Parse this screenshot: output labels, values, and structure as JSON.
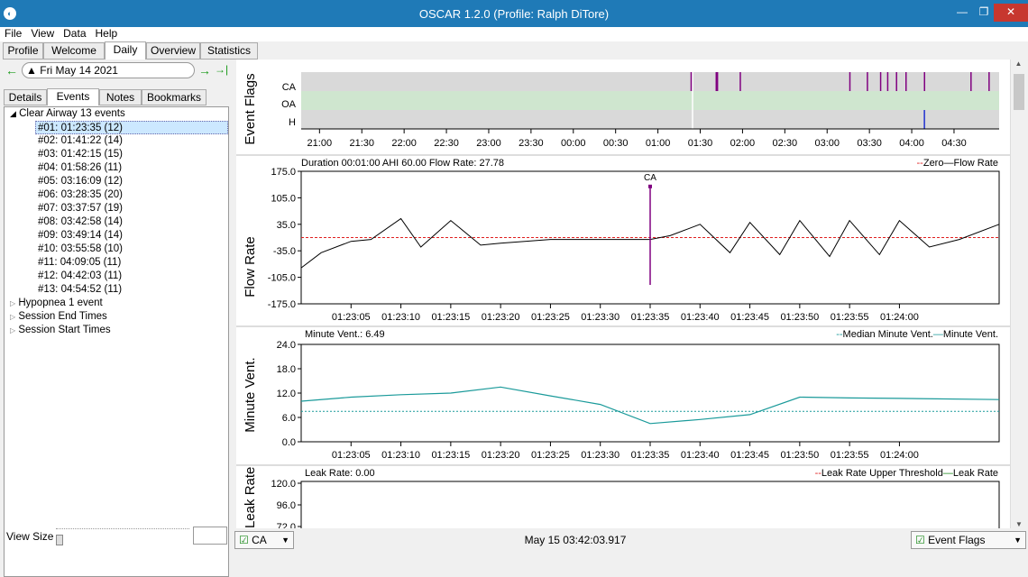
{
  "window": {
    "title": "OSCAR 1.2.0 (Profile: Ralph DiTore)",
    "app_icon": "oscar-app-icon"
  },
  "menu": [
    "File",
    "View",
    "Data",
    "Help"
  ],
  "main_tabs": [
    {
      "label": "Profile"
    },
    {
      "label": "Welcome"
    },
    {
      "label": "Daily",
      "active": true
    },
    {
      "label": "Overview"
    },
    {
      "label": "Statistics"
    }
  ],
  "date_nav": {
    "date": "Fri May 14 2021"
  },
  "sub_tabs": [
    {
      "label": "Details"
    },
    {
      "label": "Events",
      "active": true
    },
    {
      "label": "Notes"
    },
    {
      "label": "Bookmarks"
    }
  ],
  "event_tree": {
    "clear_airway": "Clear Airway 13 events",
    "items": [
      "#01: 01:23:35 (12)",
      "#02: 01:41:22 (14)",
      "#03: 01:42:15 (15)",
      "#04: 01:58:26 (11)",
      "#05: 03:16:09 (12)",
      "#06: 03:28:35 (20)",
      "#07: 03:37:57 (19)",
      "#08: 03:42:58 (14)",
      "#09: 03:49:14 (14)",
      "#10: 03:55:58 (10)",
      "#11: 04:09:05 (11)",
      "#12: 04:42:03 (11)",
      "#13: 04:54:52 (11)"
    ],
    "hypopnea": "Hypopnea 1 event",
    "session_end": "Session End Times",
    "session_start": "Session Start Times"
  },
  "view_size_label": "View Size",
  "event_flags": {
    "ylabel": "Event Flags",
    "rows": [
      "CA",
      "OA",
      "H"
    ],
    "time_ticks": [
      "21:00",
      "21:30",
      "22:00",
      "22:30",
      "23:00",
      "23:30",
      "00:00",
      "00:30",
      "01:00",
      "01:30",
      "02:00",
      "02:30",
      "03:00",
      "03:30",
      "04:00",
      "04:30"
    ]
  },
  "flow_rate": {
    "ylabel": "Flow Rate",
    "header": "Duration 00:01:00 AHI 60.00 Flow Rate: 27.78",
    "legend_zero": "Zero",
    "legend_flow": "Flow Rate",
    "yticks": [
      "175.0",
      "105.0",
      "35.0",
      "-35.0",
      "-105.0",
      "-175.0"
    ],
    "event_label": "CA"
  },
  "minute_vent": {
    "ylabel": "Minute Vent.",
    "header": "Minute Vent.: 6.49",
    "legend_median": "Median Minute Vent.",
    "legend_series": "Minute Vent.",
    "yticks": [
      "24.0",
      "18.0",
      "12.0",
      "6.0",
      "0.0"
    ]
  },
  "leak_rate": {
    "ylabel": "Leak Rate",
    "header": "Leak Rate: 0.00",
    "legend_threshold": "Leak Rate Upper Threshold",
    "legend_series": "Leak Rate",
    "yticks": [
      "120.0",
      "96.0",
      "72.0"
    ]
  },
  "zoom_ticks": [
    "01:23:05",
    "01:23:10",
    "01:23:15",
    "01:23:20",
    "01:23:25",
    "01:23:30",
    "01:23:35",
    "01:23:40",
    "01:23:45",
    "01:23:50",
    "01:23:55",
    "01:24:00"
  ],
  "status": {
    "left_combo": "CA",
    "center": "May 15 03:42:03.917",
    "right_combo": "Event Flags"
  },
  "colors": {
    "flow": "#000000",
    "zero": "#e02020",
    "vent": "#1a9a9a",
    "ca_flag": "#800080",
    "h_flag": "#2030d0",
    "oa_band": "#cfe6cf"
  },
  "chart_data": [
    {
      "type": "scatter",
      "title": "Event Flags",
      "x_range": [
        "20:47",
        "05:02"
      ],
      "series": [
        {
          "name": "CA",
          "x": [
            "01:23:35",
            "01:41:22",
            "01:42:15",
            "01:58:26",
            "03:16:09",
            "03:28:35",
            "03:37:57",
            "03:42:58",
            "03:49:14",
            "03:55:58",
            "04:09:05",
            "04:42:03",
            "04:54:52"
          ]
        },
        {
          "name": "H",
          "x": [
            "04:09"
          ]
        }
      ]
    },
    {
      "type": "line",
      "ylabel": "Flow Rate",
      "ylim": [
        -175,
        175
      ],
      "x_range": [
        "01:23:00",
        "01:24:10"
      ],
      "series": [
        {
          "name": "Zero",
          "style": "dashed",
          "y": 0
        },
        {
          "name": "Flow Rate",
          "x": [
            "01:23:00",
            "01:23:02",
            "01:23:05",
            "01:23:07",
            "01:23:10",
            "01:23:12",
            "01:23:15",
            "01:23:18",
            "01:23:20",
            "01:23:25",
            "01:23:30",
            "01:23:35",
            "01:23:37",
            "01:23:40",
            "01:23:43",
            "01:23:45",
            "01:23:48",
            "01:23:50",
            "01:23:53",
            "01:23:55",
            "01:23:58",
            "01:24:00",
            "01:24:03",
            "01:24:06",
            "01:24:10"
          ],
          "y": [
            -80,
            -40,
            -10,
            -5,
            50,
            -25,
            45,
            -20,
            -15,
            -5,
            -5,
            -5,
            5,
            35,
            -40,
            40,
            -45,
            45,
            -50,
            45,
            -45,
            45,
            -25,
            -5,
            35
          ]
        }
      ]
    },
    {
      "type": "line",
      "ylabel": "Minute Vent.",
      "ylim": [
        0,
        24
      ],
      "x_range": [
        "01:23:00",
        "01:24:10"
      ],
      "series": [
        {
          "name": "Median Minute Vent.",
          "style": "dashed",
          "y": 7.5
        },
        {
          "name": "Minute Vent.",
          "x": [
            "01:23:00",
            "01:23:05",
            "01:23:10",
            "01:23:15",
            "01:23:20",
            "01:23:25",
            "01:23:30",
            "01:23:35",
            "01:23:40",
            "01:23:45",
            "01:23:50",
            "01:23:55",
            "01:24:00",
            "01:24:10"
          ],
          "y": [
            10,
            11,
            11.6,
            12,
            13.5,
            11.3,
            9.2,
            4.5,
            5.5,
            6.7,
            11,
            10.8,
            10.7,
            10.4
          ]
        }
      ]
    }
  ]
}
